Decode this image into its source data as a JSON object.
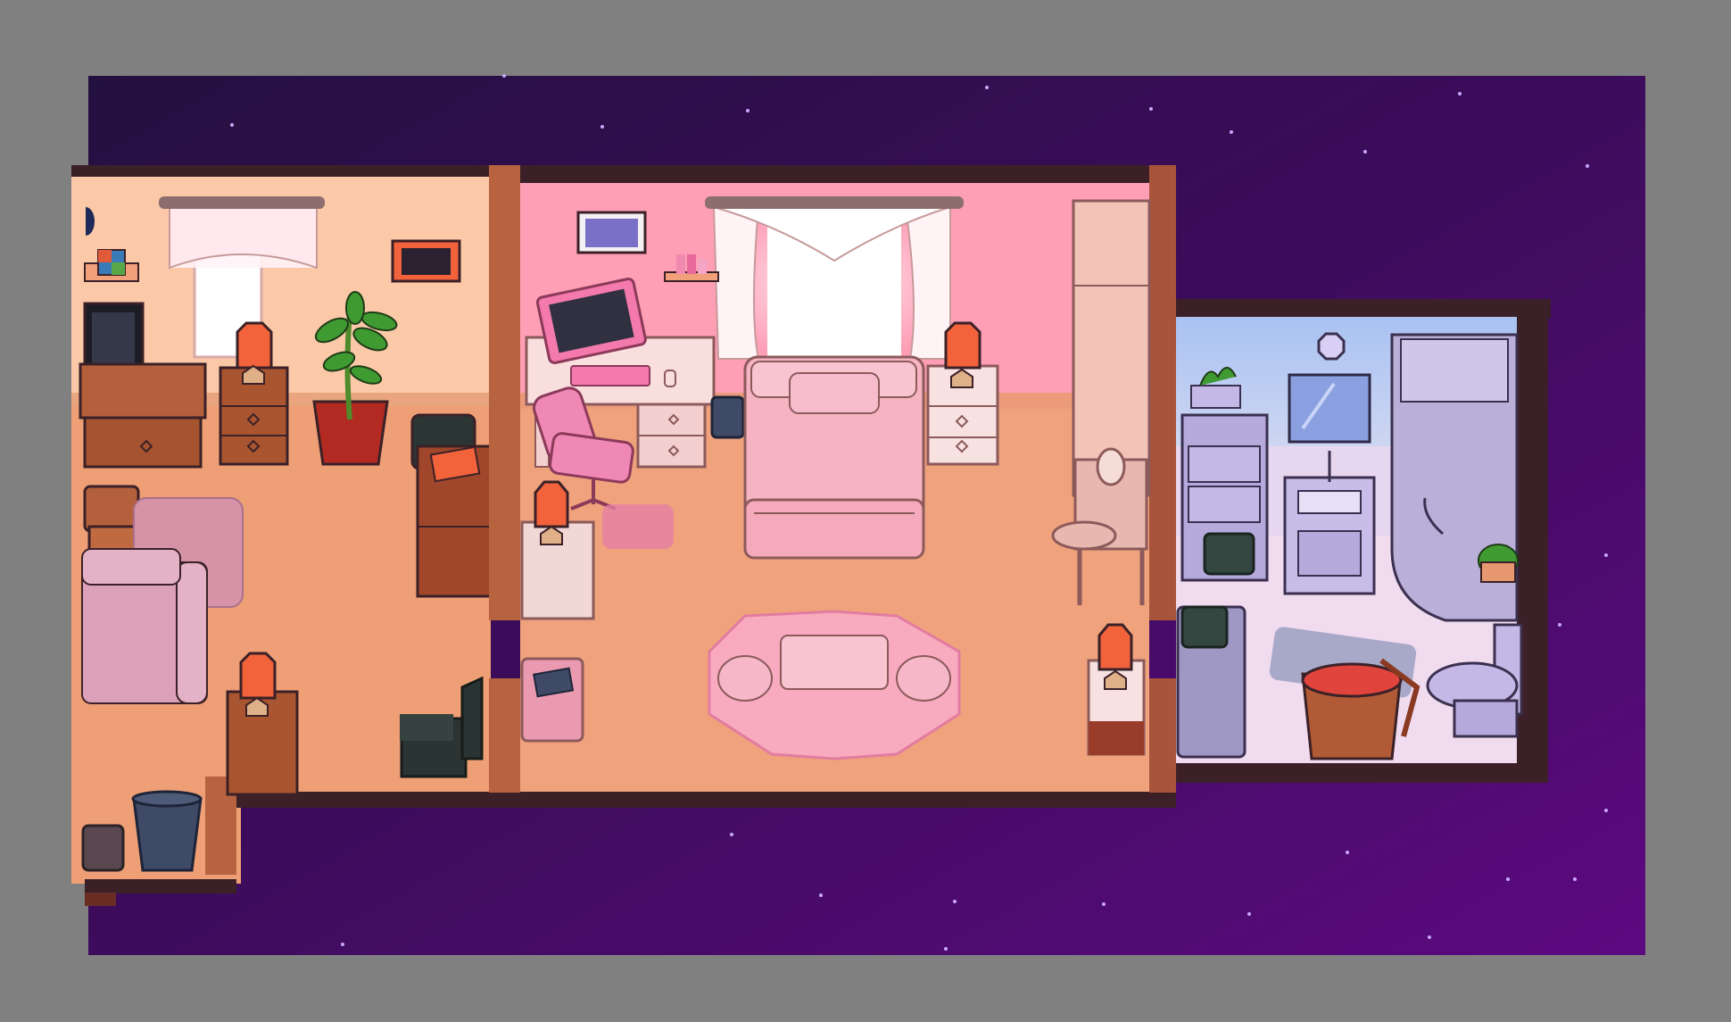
{
  "game": {
    "view": "house-cutaway",
    "palette": {
      "background": "#808080",
      "space_dark": "#2a0f47",
      "space_light": "#5b0c7d",
      "wall_trim": "#3b2127",
      "floor_living": "#ee9f75",
      "floor_bedroom": "#efa27c",
      "wall_living": "#fbc9aa",
      "wall_bedroom": "#ff9fb8",
      "wall_bathroom": "#b6c9f2",
      "floor_bathroom": "#efd9ef",
      "furniture_wood": "#b05a36",
      "furniture_pink": "#f2b0c0",
      "lamp_shade": "#f2623b",
      "accent_pink": "#f479ad"
    },
    "rooms": [
      {
        "id": "living-room",
        "icons": [
          "tv-icon",
          "plant-icon",
          "armchair-icon",
          "lamp-icon",
          "trash-bin-icon"
        ]
      },
      {
        "id": "bedroom",
        "icons": [
          "bed-icon",
          "computer-desk-icon",
          "office-chair-icon",
          "rug-icon",
          "wardrobe-icon"
        ]
      },
      {
        "id": "bathroom",
        "icons": [
          "sink-icon",
          "shower-icon",
          "toilet-icon",
          "laundry-basket-icon"
        ]
      }
    ]
  }
}
